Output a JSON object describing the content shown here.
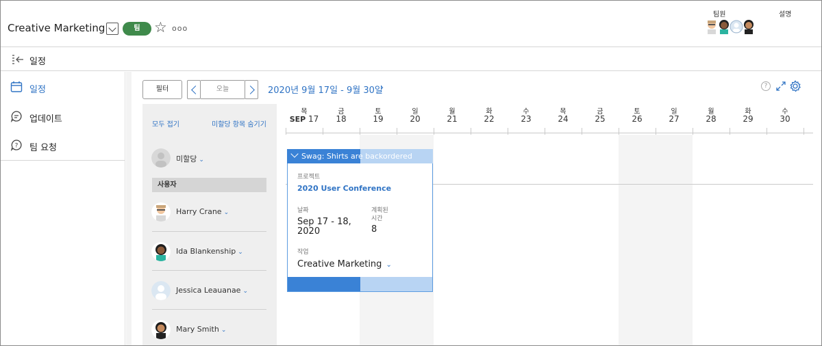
{
  "header": {
    "title": "Creative Marketing",
    "badge": "팀",
    "members_label": "팀원",
    "description_label": "설명",
    "more": "ooo"
  },
  "subheader": {
    "title": "일정"
  },
  "sidebar": {
    "items": [
      {
        "label": "일정",
        "icon": "calendar-icon",
        "active": true
      },
      {
        "label": "업데이트",
        "icon": "chat-bubble-icon",
        "active": false
      },
      {
        "label": "팀 요청",
        "icon": "question-bubble-icon",
        "active": false
      }
    ]
  },
  "toolbar": {
    "filter_label": "필터",
    "today_label": "오늘",
    "date_range": "2020년 9월 17일 - 9월 30일",
    "range_caret": "›",
    "help": "?"
  },
  "resources": {
    "collapse_all": "모두 접기",
    "hide_unassigned": "미할당 항목 숨기기",
    "unassigned_label": "미할당",
    "users_section": "사용자",
    "people": [
      {
        "name": "Harry Crane"
      },
      {
        "name": "Ida Blankenship"
      },
      {
        "name": "Jessica Leauanae"
      },
      {
        "name": "Mary Smith"
      }
    ]
  },
  "timeline": {
    "days": [
      {
        "weekday": "목",
        "day": "17",
        "month": "SEP"
      },
      {
        "weekday": "금",
        "day": "18"
      },
      {
        "weekday": "토",
        "day": "19"
      },
      {
        "weekday": "일",
        "day": "20"
      },
      {
        "weekday": "월",
        "day": "21"
      },
      {
        "weekday": "화",
        "day": "22"
      },
      {
        "weekday": "수",
        "day": "23"
      },
      {
        "weekday": "목",
        "day": "24"
      },
      {
        "weekday": "금",
        "day": "25"
      },
      {
        "weekday": "토",
        "day": "26"
      },
      {
        "weekday": "일",
        "day": "27"
      },
      {
        "weekday": "월",
        "day": "28"
      },
      {
        "weekday": "화",
        "day": "29"
      },
      {
        "weekday": "수",
        "day": "30"
      }
    ]
  },
  "task": {
    "name": "Swag: Shirts are backordered",
    "progress_fraction": 0.5,
    "project_label": "프로젝트",
    "project_name": "2020 User Conference",
    "date_label": "날짜",
    "date_value_line1": "Sep 17 - 18,",
    "date_value_line2": "2020",
    "planned_label_line1": "계획된",
    "planned_label_line2": "시간",
    "planned_value": "8",
    "assignee_label": "작업",
    "assignee_value": "Creative Marketing"
  },
  "colors": {
    "accent": "#2f73c4",
    "team_badge": "#3f8a4b",
    "task_done": "#3a82d6",
    "task_remaining": "#b8d4f3"
  }
}
